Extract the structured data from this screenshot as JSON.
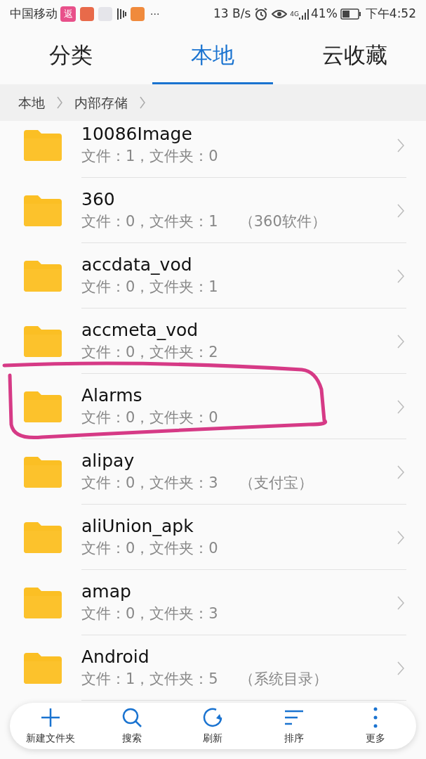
{
  "status_bar": {
    "carrier": "中国移动",
    "notification_icons": [
      "返"
    ],
    "more": "···",
    "speed": "13 B/s",
    "network": "4G",
    "battery": "41%",
    "time": "下午4:52"
  },
  "tabs": [
    {
      "label": "分类",
      "selected": false
    },
    {
      "label": "本地",
      "selected": true
    },
    {
      "label": "云收藏",
      "selected": false
    }
  ],
  "breadcrumb": [
    "本地",
    "内部存储"
  ],
  "folders": [
    {
      "name": "10086Image",
      "info": "文件：1，文件夹：0"
    },
    {
      "name": "360",
      "info": "文件：0，文件夹：1",
      "note": "（360软件）"
    },
    {
      "name": "accdata_vod",
      "info": "文件：0，文件夹：1"
    },
    {
      "name": "accmeta_vod",
      "info": "文件：0，文件夹：2"
    },
    {
      "name": "Alarms",
      "info": "文件：0，文件夹：0",
      "circled": true
    },
    {
      "name": "alipay",
      "info": "文件：0，文件夹：3",
      "note": "（支付宝）"
    },
    {
      "name": "aliUnion_apk",
      "info": "文件：0，文件夹：0"
    },
    {
      "name": "amap",
      "info": "文件：0，文件夹：3"
    },
    {
      "name": "Android",
      "info": "文件：1，文件夹：5",
      "note": "（系统目录）"
    }
  ],
  "toolbar": [
    {
      "kind": "add",
      "label": "新建文件夹"
    },
    {
      "kind": "search",
      "label": "搜索"
    },
    {
      "kind": "refresh",
      "label": "刷新"
    },
    {
      "kind": "sort",
      "label": "排序"
    },
    {
      "kind": "more",
      "label": "更多"
    }
  ]
}
